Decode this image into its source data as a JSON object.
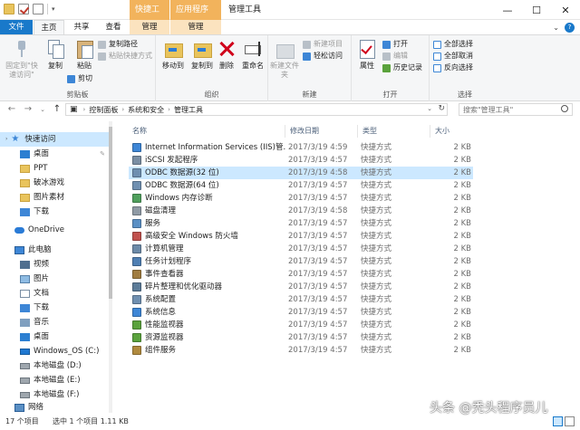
{
  "window": {
    "title": "管理工具",
    "minimize_icon": "minimize-icon",
    "maximize_icon": "maximize-icon",
    "close_icon": "close-icon"
  },
  "tabs": {
    "file": "文件",
    "home": "主页",
    "share": "共享",
    "view": "查看",
    "context_manage_1_group": "快捷工具",
    "context_manage_1": "管理",
    "context_manage_2_group": "应用程序工具",
    "context_manage_2": "管理"
  },
  "ribbon": {
    "clipboard": {
      "label": "剪贴板",
      "pin_quick_access": "固定到\"快速访问\"",
      "copy": "复制",
      "paste": "粘贴",
      "copy_path": "复制路径",
      "paste_shortcut": "粘贴快捷方式",
      "cut": "剪切"
    },
    "organize": {
      "label": "组织",
      "move_to": "移动到",
      "copy_to": "复制到",
      "delete": "删除",
      "rename": "重命名"
    },
    "new": {
      "label": "新建",
      "new_folder": "新建文件夹",
      "new_item": "新建项目",
      "easy_access": "轻松访问"
    },
    "open": {
      "label": "打开",
      "properties": "属性",
      "open": "打开",
      "edit": "编辑",
      "history": "历史记录"
    },
    "select": {
      "label": "选择",
      "select_all": "全部选择",
      "select_none": "全部取消",
      "invert_selection": "反向选择"
    }
  },
  "address": {
    "breadcrumbs": [
      "控制面板",
      "系统和安全",
      "管理工具"
    ],
    "search_placeholder": "搜索\"管理工具\""
  },
  "nav": {
    "quick_access": "快速访问",
    "items": [
      "桌面",
      "PPT",
      "破冰游戏",
      "图片素材",
      "下载"
    ],
    "onedrive": "OneDrive",
    "this_pc": "此电脑",
    "pc_items": [
      "视频",
      "图片",
      "文档",
      "下载",
      "音乐",
      "桌面"
    ],
    "drives": [
      "Windows_OS (C:)",
      "本地磁盘 (D:)",
      "本地磁盘 (E:)",
      "本地磁盘 (F:)"
    ],
    "network": "网络"
  },
  "columns": {
    "name": "名称",
    "date": "修改日期",
    "type": "类型",
    "size": "大小"
  },
  "files": [
    {
      "name": "Internet Information Services (IIS)管...",
      "date": "2017/3/19 4:59",
      "type": "快捷方式",
      "size": "2 KB",
      "color": "#3d86d6",
      "selected": false
    },
    {
      "name": "iSCSI 发起程序",
      "date": "2017/3/19 4:57",
      "type": "快捷方式",
      "size": "2 KB",
      "color": "#7a8ea3",
      "selected": false
    },
    {
      "name": "ODBC 数据源(32 位)",
      "date": "2017/3/19 4:58",
      "type": "快捷方式",
      "size": "2 KB",
      "color": "#6f8fb0",
      "selected": true
    },
    {
      "name": "ODBC 数据源(64 位)",
      "date": "2017/3/19 4:57",
      "type": "快捷方式",
      "size": "2 KB",
      "color": "#6f8fb0",
      "selected": false
    },
    {
      "name": "Windows 内存诊断",
      "date": "2017/3/19 4:57",
      "type": "快捷方式",
      "size": "2 KB",
      "color": "#4f9f5c",
      "selected": false
    },
    {
      "name": "磁盘清理",
      "date": "2017/3/19 4:58",
      "type": "快捷方式",
      "size": "2 KB",
      "color": "#8f9aa5",
      "selected": false
    },
    {
      "name": "服务",
      "date": "2017/3/19 4:57",
      "type": "快捷方式",
      "size": "2 KB",
      "color": "#5a8fc4",
      "selected": false
    },
    {
      "name": "高级安全 Windows 防火墙",
      "date": "2017/3/19 4:57",
      "type": "快捷方式",
      "size": "2 KB",
      "color": "#c0504d",
      "selected": false
    },
    {
      "name": "计算机管理",
      "date": "2017/3/19 4:57",
      "type": "快捷方式",
      "size": "2 KB",
      "color": "#6c8aa8",
      "selected": false
    },
    {
      "name": "任务计划程序",
      "date": "2017/3/19 4:57",
      "type": "快捷方式",
      "size": "2 KB",
      "color": "#4f7fb3",
      "selected": false
    },
    {
      "name": "事件查看器",
      "date": "2017/3/19 4:57",
      "type": "快捷方式",
      "size": "2 KB",
      "color": "#a07c3f",
      "selected": false
    },
    {
      "name": "碎片整理和优化驱动器",
      "date": "2017/3/19 4:57",
      "type": "快捷方式",
      "size": "2 KB",
      "color": "#5b7b98",
      "selected": false
    },
    {
      "name": "系统配置",
      "date": "2017/3/19 4:57",
      "type": "快捷方式",
      "size": "2 KB",
      "color": "#6f8fb0",
      "selected": false
    },
    {
      "name": "系统信息",
      "date": "2017/3/19 4:57",
      "type": "快捷方式",
      "size": "2 KB",
      "color": "#3d86d6",
      "selected": false
    },
    {
      "name": "性能监视器",
      "date": "2017/3/19 4:57",
      "type": "快捷方式",
      "size": "2 KB",
      "color": "#5aa23c",
      "selected": false
    },
    {
      "name": "资源监视器",
      "date": "2017/3/19 4:57",
      "type": "快捷方式",
      "size": "2 KB",
      "color": "#5aa23c",
      "selected": false
    },
    {
      "name": "组件服务",
      "date": "2017/3/19 4:57",
      "type": "快捷方式",
      "size": "2 KB",
      "color": "#b08a3e",
      "selected": false
    }
  ],
  "status": {
    "count": "17 个项目",
    "selection": "选中 1 个项目  1.11 KB"
  },
  "watermark": "头条 @秃头程序员儿",
  "colors": {
    "accent": "#1979ca",
    "selection": "#cce8ff",
    "context_tab": "#f2b35c"
  }
}
